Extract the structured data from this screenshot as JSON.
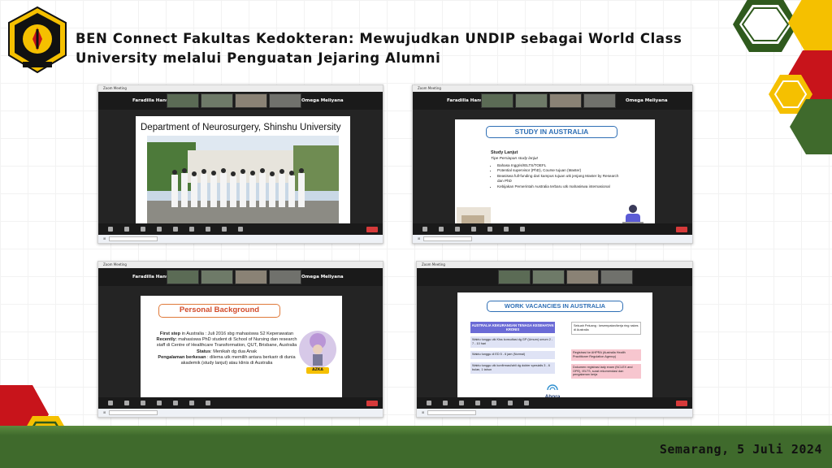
{
  "header": {
    "title_line1": "BEN Connect Fakultas Kedokteran: Mewujudkan UNDIP sebagai World Class",
    "title_line2": "University melalui Penguatan Jejaring Alumni",
    "logo_top_text": "UNIVERSITAS DIPONEGORO",
    "logo_bottom_text": "SEMARANG"
  },
  "footer": {
    "date": "Semarang, 5 Juli 2024"
  },
  "colors": {
    "green": "#3f6a2c",
    "red": "#c8141b",
    "yellow": "#f5c000",
    "dark_green": "#2f5a1d"
  },
  "panels": [
    {
      "window_title": "Zoom Meeting",
      "name_left": "Faradilla Hanun...",
      "name_right": "Omega Meliyana",
      "slide": {
        "title": "Department of Neurosurgery, Shinshu University"
      }
    },
    {
      "window_title": "Zoom Meeting",
      "name_left": "Faradilla Hanun...",
      "name_right": "Omega Meliyana",
      "slide": {
        "title": "STUDY IN AUSTRALIA",
        "heading": "Study Lanjut",
        "subheading": "Tipe Persiapan study lanjut",
        "bullets": [
          "Bahasa Inggris/IELTS/TOEFL",
          "Potential supervisor (PhD), Course tujuan (Master)",
          "Beasiswa full-funding dari kampus tujuan utk jenjang Master by Research dan PhD",
          "Kebijakan Pemerintah Australia terbaru utk mahasiswa internasional"
        ]
      }
    },
    {
      "window_title": "Zoom Meeting",
      "name_left": "Faradilla Hanun...",
      "name_right": "Omega Meliyana",
      "slide": {
        "title": "Personal Background",
        "line1_bold": "First step",
        "line1_rest": " in Australia : Juli 2016 sbg mahasiswa S2 Keperawatan",
        "line2_bold": "Recently:",
        "line2_rest": " mahasiswa PhD student di School of Nursing dan research staff di Centre of Healthcare Transformation, QUT, Brisbane, Australia",
        "line3_bold": "Status",
        "line3_rest": ": Menikah dg dua Anak",
        "line4_bold": "Pengalaman berkesan",
        "line4_rest": " : dilema utk memilih antara berkarir di dunia akademik (study lanjut) atau klinis di Australia",
        "badge": "AZKA"
      }
    },
    {
      "window_title": "Zoom Meeting",
      "slide": {
        "title": "WORK VACANCIES IN AUSTRALIA",
        "box_header": "AUSTRALIA KEKURANGAN TENAGA KESEHATAN KRONIS",
        "left_items": [
          "Waktu tunggu utk Kiss konsultasi dg GP (Umum) umum 2 - 7 - 10 hari",
          "Waktu tunggu di ED 5 - 6 jam (Normal)",
          "Waktu tunggu utk konfirmasi/ahli dg dokter spesialis 3 - 6 bulan, 1 tahun"
        ],
        "right_items": [
          "Sekuah Peluang : kesempatan/kerja ring nakes di Australia",
          "Registrasi ke AHPRA (Australia Health Practitioner Regulation Agency)",
          "Dokumen registrasi lady exam (NCLEX and OPE), IELTS, surat rekomendasi dan pengalaman kerja"
        ],
        "brand": "Ahpra",
        "brand_sub": "& National Boards"
      }
    }
  ]
}
